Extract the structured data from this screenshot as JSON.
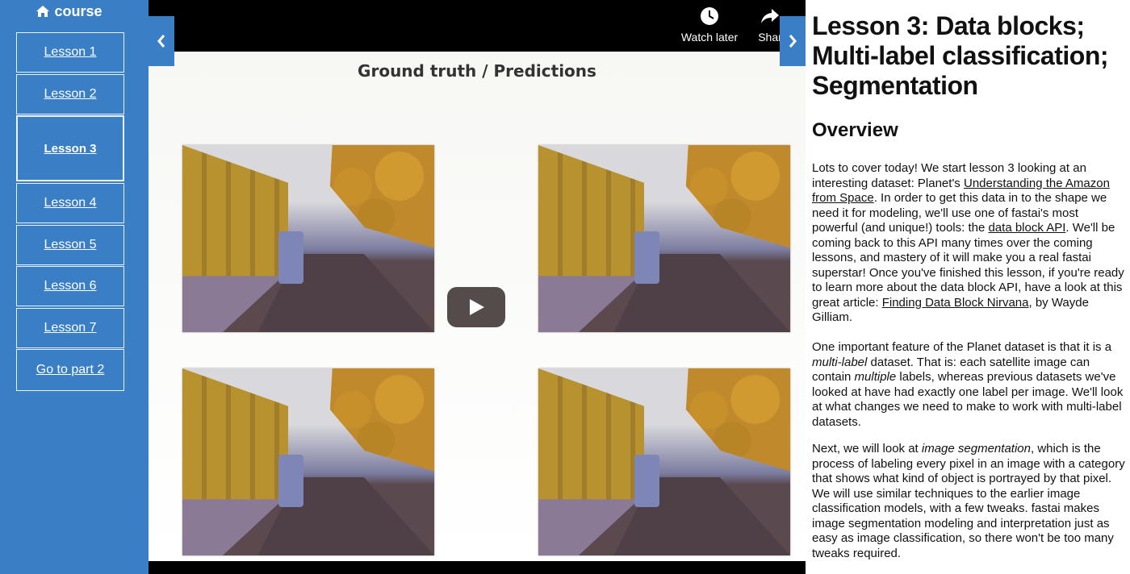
{
  "sidebar": {
    "brand": "course",
    "brand_icon": "home-icon",
    "items": [
      {
        "label": "Lesson 1",
        "active": false
      },
      {
        "label": "Lesson 2",
        "active": false
      },
      {
        "label": "Lesson 3",
        "active": true
      },
      {
        "label": "Lesson 4",
        "active": false
      },
      {
        "label": "Lesson 5",
        "active": false
      },
      {
        "label": "Lesson 6",
        "active": false
      },
      {
        "label": "Lesson 7",
        "active": false
      },
      {
        "label": "Go to part 2",
        "active": false
      }
    ]
  },
  "video": {
    "slide_title": "Ground truth / Predictions",
    "watch_later": "Watch later",
    "share": "Shar"
  },
  "content": {
    "title": "Lesson 3: Data blocks; Multi-label classification; Segmentation",
    "overview_heading": "Overview",
    "p1": {
      "t1": "Lots to cover today! We start lesson 3 looking at an interesting dataset: Planet's ",
      "link1": "Understanding the Amazon from Space",
      "t2": ". In order to get this data in to the shape we need it for modeling, we'll use one of fastai's most powerful (and unique!) tools: the ",
      "link2": "data block API",
      "t3": ". We'll be coming back to this API many times over the coming lessons, and mastery of it will make you a real fastai superstar! Once you've finished this lesson, if you're ready to learn more about the data block API, have a look at this great article: ",
      "link3": "Finding Data Block Nirvana",
      "t4": ", by Wayde Gilliam."
    },
    "p2": {
      "t1": "One important feature of the Planet dataset is that it is a ",
      "em1": "multi-label",
      "t2": " dataset. That is: each satellite image can contain ",
      "em2": "multiple",
      "t3": " labels, whereas previous datasets we've looked at have had exactly one label per image. We'll look at what changes we need to make to work with multi-label datasets."
    },
    "p3": {
      "t1": "Next, we will look at ",
      "em1": "image segmentation",
      "t2": ", which is the process of labeling every pixel in an image with a category that shows what kind of object is portrayed by that pixel. We will use similar techniques to the earlier image classification models, with a few tweaks. fastai makes image segmentation modeling and interpretation just as easy as image classification, so there won't be too many tweaks required."
    }
  },
  "colors": {
    "sidebar_bg": "#3a7fc5",
    "video_bg": "#000000",
    "text": "#111111"
  }
}
